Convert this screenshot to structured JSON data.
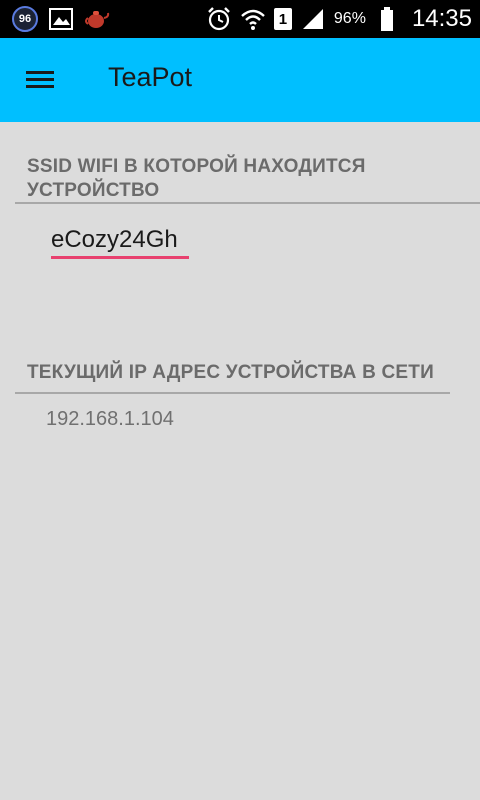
{
  "status_bar": {
    "badge_number": "96",
    "sim_slot": "1",
    "battery_percent": "96%",
    "time": "14:35",
    "icons": [
      "badge-96-icon",
      "gallery-icon",
      "teapot-app-icon",
      "alarm-icon",
      "wifi-icon",
      "sim-1-icon",
      "signal-icon",
      "battery-icon"
    ]
  },
  "app_bar": {
    "title": "TeaPot",
    "color": "#00bfff",
    "menu_icon": "hamburger-menu-icon"
  },
  "ssid_section": {
    "header": "SSID WIFI В КОТОРОЙ НАХОДИТСЯ УСТРОЙСТВО",
    "value": "eCozy24Gh",
    "underline_color": "#e8416f"
  },
  "ip_section": {
    "header": "ТЕКУЩИЙ IP АДРЕС УСТРОЙСТВА В СЕТИ",
    "value": "192.168.1.104"
  }
}
